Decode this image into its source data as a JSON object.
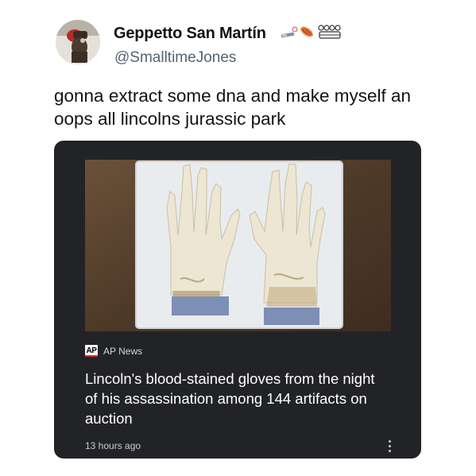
{
  "author": {
    "display_name": "Geppetto San Martín",
    "handle": "@SmalltimeJones",
    "avatar_icon": "avatar-icon",
    "name_emojis": [
      "baseball-bat-ball-icon",
      "hotdog-icon",
      "crowd-icon"
    ]
  },
  "tweet": {
    "text": "gonna extract some dna and make myself an oops all lincolns jurassic park"
  },
  "card": {
    "background_color": "#222326",
    "image_description_icon": "gloves-photo",
    "source": {
      "logo_text": "AP",
      "name": "AP News"
    },
    "headline": "Lincoln's blood-stained gloves from the night of his assassination among 144 artifacts on auction",
    "timestamp": "13 hours ago",
    "more_icon": "more-vertical-icon"
  },
  "colors": {
    "handle": "#536471",
    "card_text": "#ffffff",
    "card_meta": "#c9cbcf"
  }
}
